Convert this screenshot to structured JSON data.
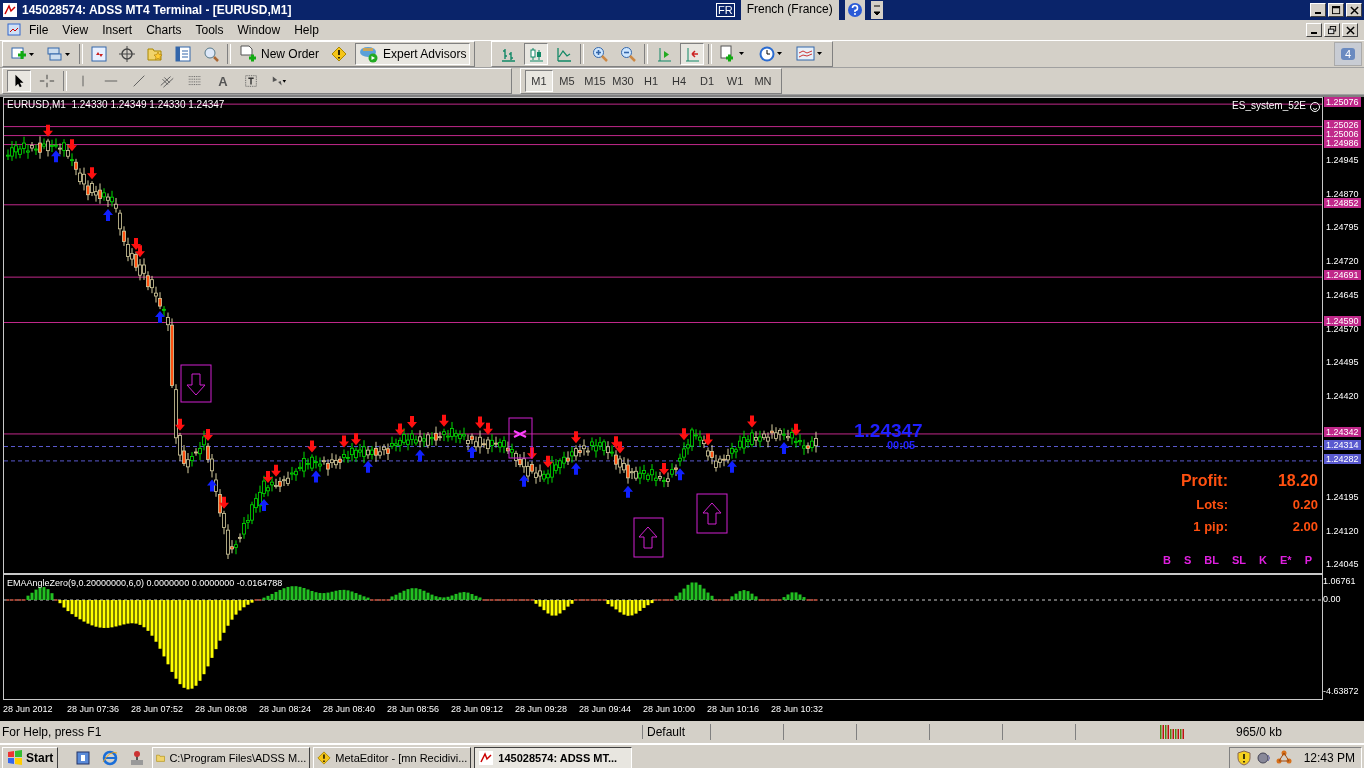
{
  "window": {
    "title": "145028574: ADSS MT4 Terminal - [EURUSD,M1]",
    "language": {
      "code": "FR",
      "name": "French (France)"
    }
  },
  "menu": [
    "File",
    "View",
    "Insert",
    "Charts",
    "Tools",
    "Window",
    "Help"
  ],
  "toolbar": {
    "new_order": "New Order",
    "expert_advisors": {
      "label": "Expert Advisors",
      "selected": true
    },
    "notifications": "4",
    "chart_buttons": [
      {
        "kind": "bars",
        "selected": false
      },
      {
        "kind": "candles",
        "selected": true
      },
      {
        "kind": "line",
        "selected": false
      },
      {
        "kind": "zoom-in",
        "selected": false
      },
      {
        "kind": "zoom-out",
        "selected": false
      },
      {
        "kind": "shift",
        "selected": false
      },
      {
        "kind": "autoscroll",
        "selected": true
      }
    ]
  },
  "drawing_tools": [
    {
      "kind": "cursor",
      "selected": true
    },
    {
      "kind": "crosshair",
      "selected": false
    },
    {
      "kind": "vline",
      "selected": false
    },
    {
      "kind": "hline",
      "selected": false
    },
    {
      "kind": "trend",
      "selected": false
    },
    {
      "kind": "channel",
      "selected": false
    },
    {
      "kind": "fibo",
      "selected": false
    },
    {
      "kind": "text",
      "label": "A",
      "selected": false
    },
    {
      "kind": "label",
      "selected": false
    },
    {
      "kind": "arrows",
      "selected": false
    }
  ],
  "timeframes": [
    {
      "label": "M1",
      "selected": true
    },
    {
      "label": "M5",
      "selected": false
    },
    {
      "label": "M15",
      "selected": false
    },
    {
      "label": "M30",
      "selected": false
    },
    {
      "label": "H1",
      "selected": false
    },
    {
      "label": "H4",
      "selected": false
    },
    {
      "label": "D1",
      "selected": false
    },
    {
      "label": "W1",
      "selected": false
    },
    {
      "label": "MN",
      "selected": false
    }
  ],
  "chart": {
    "header": "EURUSD,M1  1.24330 1.24349 1.24330 1.24347",
    "expert": "ES_system_52E",
    "bid": "1.24347",
    "countdown": "00:05",
    "stats": [
      {
        "label": "Profit:",
        "value": "18.20"
      },
      {
        "label": "Lots:",
        "value": "0.20"
      },
      {
        "label": "1 pip:",
        "value": "2.00"
      }
    ],
    "buttons": [
      "B",
      "S",
      "BL",
      "SL",
      "K",
      "E*",
      "P"
    ],
    "price_levels": [
      {
        "price": "1.25076",
        "color": "#c0288a"
      },
      {
        "price": "1.25026",
        "color": "#c0288a"
      },
      {
        "price": "1.25006",
        "color": "#c0288a"
      },
      {
        "price": "1.24986",
        "color": "#c0288a"
      },
      {
        "price": "1.24852",
        "color": "#c0288a"
      },
      {
        "price": "1.24691",
        "color": "#c0288a"
      },
      {
        "price": "1.24590",
        "color": "#c0288a"
      },
      {
        "price": "1.24342",
        "color": "#c0288a"
      },
      {
        "price": "1.24314",
        "color": "#5a5ad0"
      },
      {
        "price": "1.24282",
        "color": "#5a5ad0"
      }
    ],
    "price_ticks": [
      "1.24945",
      "1.24870",
      "1.24795",
      "1.24720",
      "1.24645",
      "1.24570",
      "1.24495",
      "1.24420",
      "1.24195",
      "1.24120",
      "1.24045"
    ]
  },
  "indicator": {
    "header": "EMAAngleZero(9,0.20000000,6,0) 0.0000000 0.0000000 -0.0164788",
    "axis": [
      "1.06761",
      "0.00",
      "-4.63872"
    ]
  },
  "time_axis": [
    "28 Jun 2012",
    "28 Jun 07:36",
    "28 Jun 07:52",
    "28 Jun 08:08",
    "28 Jun 08:24",
    "28 Jun 08:40",
    "28 Jun 08:56",
    "28 Jun 09:12",
    "28 Jun 09:28",
    "28 Jun 09:44",
    "28 Jun 10:00",
    "28 Jun 10:16",
    "28 Jun 10:32"
  ],
  "status_bar": {
    "help": "For Help, press F1",
    "profile": "Default",
    "traffic": "965/0 kb"
  },
  "taskbar": {
    "start": "Start",
    "tasks": [
      {
        "kind": "folder",
        "label": "C:\\Program Files\\ADSS M...",
        "selected": false
      },
      {
        "kind": "editor",
        "label": "MetaEditor - [mn Recidivi...",
        "selected": false
      },
      {
        "kind": "terminal",
        "label": "145028574: ADSS MT...",
        "selected": true
      }
    ],
    "clock": "12:43 PM"
  }
}
